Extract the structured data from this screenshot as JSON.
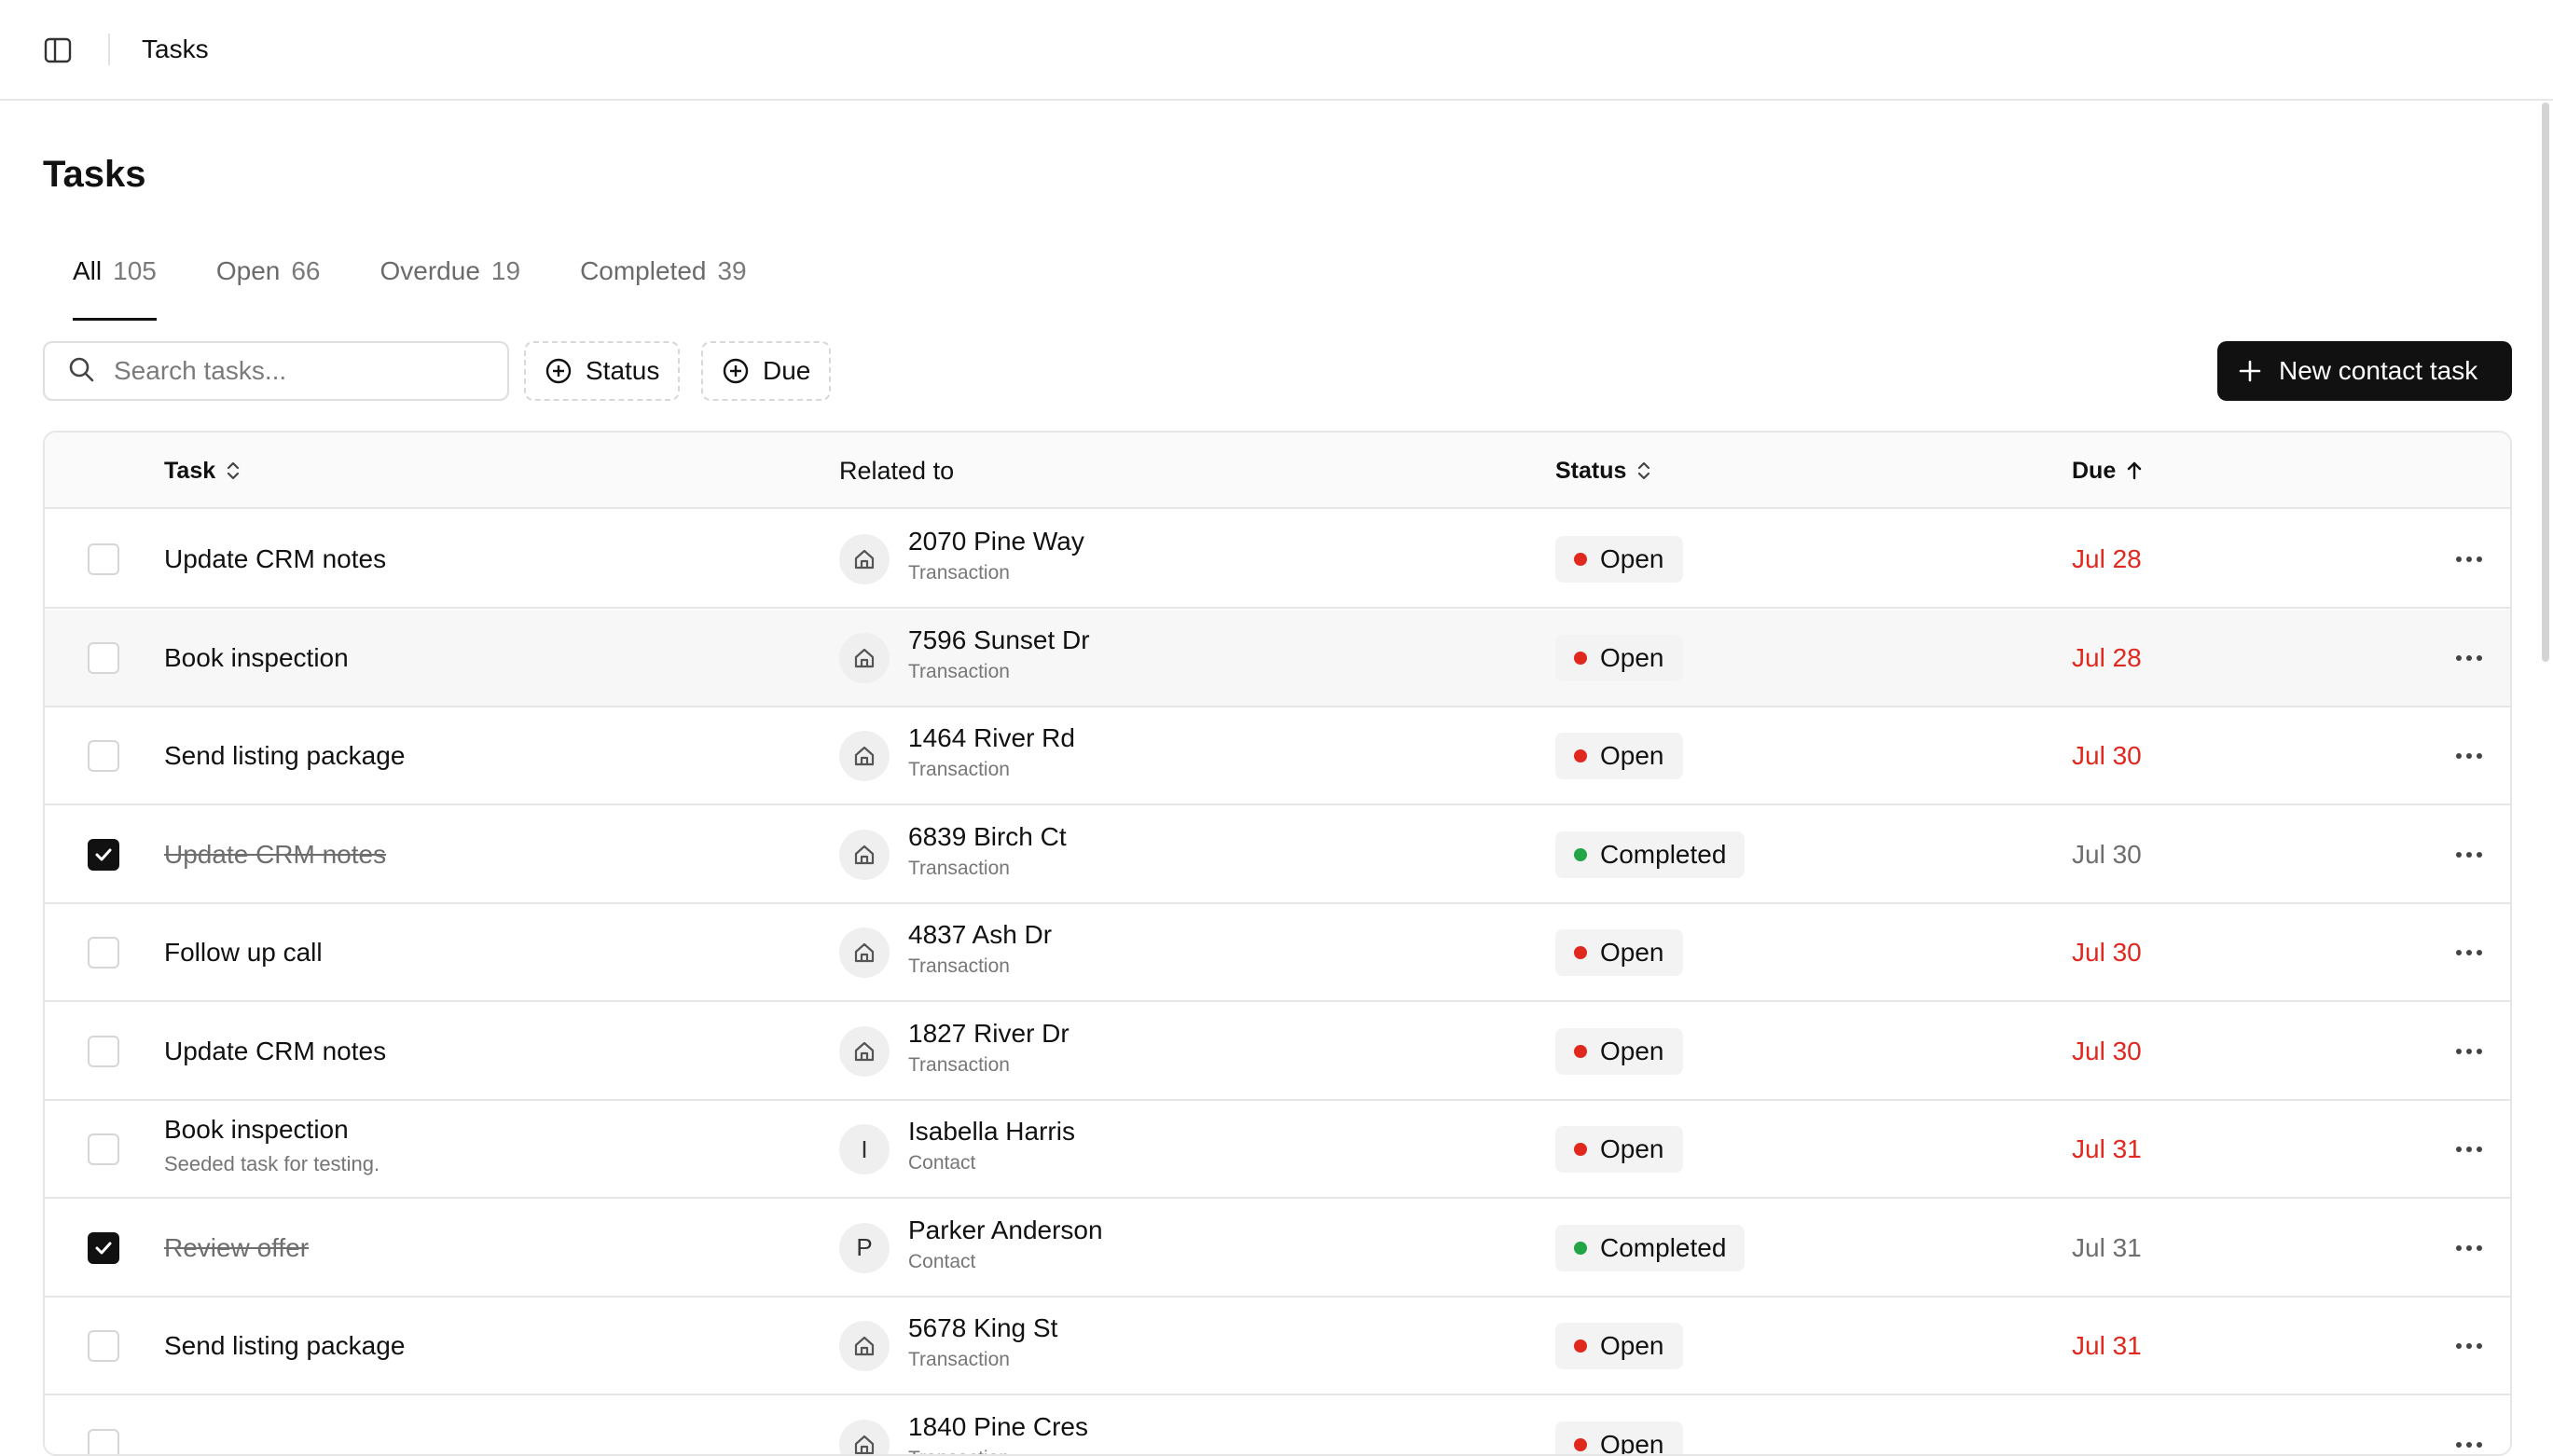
{
  "topbar": {
    "title": "Tasks"
  },
  "page": {
    "title": "Tasks"
  },
  "tabs": [
    {
      "label": "All",
      "count": "105",
      "active": true
    },
    {
      "label": "Open",
      "count": "66",
      "active": false
    },
    {
      "label": "Overdue",
      "count": "19",
      "active": false
    },
    {
      "label": "Completed",
      "count": "39",
      "active": false
    }
  ],
  "toolbar": {
    "search_placeholder": "Search tasks...",
    "filter_status": "Status",
    "filter_due": "Due",
    "new_task": "New contact task"
  },
  "table": {
    "headers": {
      "task": "Task",
      "related": "Related to",
      "status": "Status",
      "due": "Due"
    },
    "rows": [
      {
        "checked": false,
        "task": "Update CRM notes",
        "subtitle": "",
        "related_name": "2070 Pine Way",
        "related_type": "Transaction",
        "related_icon": "house-icon",
        "status": "Open",
        "due": "Jul 28",
        "overdue": true
      },
      {
        "checked": false,
        "task": "Book inspection",
        "subtitle": "",
        "related_name": "7596 Sunset Dr",
        "related_type": "Transaction",
        "related_icon": "house-icon",
        "status": "Open",
        "due": "Jul 28",
        "overdue": true
      },
      {
        "checked": false,
        "task": "Send listing package",
        "subtitle": "",
        "related_name": "1464 River Rd",
        "related_type": "Transaction",
        "related_icon": "house-icon",
        "status": "Open",
        "due": "Jul 30",
        "overdue": true
      },
      {
        "checked": true,
        "task": "Update CRM notes",
        "subtitle": "",
        "related_name": "6839 Birch Ct",
        "related_type": "Transaction",
        "related_icon": "house-icon",
        "status": "Completed",
        "due": "Jul 30",
        "overdue": false
      },
      {
        "checked": false,
        "task": "Follow up call",
        "subtitle": "",
        "related_name": "4837 Ash Dr",
        "related_type": "Transaction",
        "related_icon": "house-icon",
        "status": "Open",
        "due": "Jul 30",
        "overdue": true
      },
      {
        "checked": false,
        "task": "Update CRM notes",
        "subtitle": "",
        "related_name": "1827 River Dr",
        "related_type": "Transaction",
        "related_icon": "house-icon",
        "status": "Open",
        "due": "Jul 30",
        "overdue": true
      },
      {
        "checked": false,
        "task": "Book inspection",
        "subtitle": "Seeded task for testing.",
        "related_name": "Isabella Harris",
        "related_type": "Contact",
        "related_initial": "I",
        "status": "Open",
        "due": "Jul 31",
        "overdue": true
      },
      {
        "checked": true,
        "task": "Review offer",
        "subtitle": "",
        "related_name": "Parker Anderson",
        "related_type": "Contact",
        "related_initial": "P",
        "status": "Completed",
        "due": "Jul 31",
        "overdue": false
      },
      {
        "checked": false,
        "task": "Send listing package",
        "subtitle": "",
        "related_name": "5678 King St",
        "related_type": "Transaction",
        "related_icon": "house-icon",
        "status": "Open",
        "due": "Jul 31",
        "overdue": true
      },
      {
        "checked": false,
        "task": "",
        "subtitle": "",
        "related_name": "1840 Pine Cres",
        "related_type": "Transaction",
        "related_icon": "house-icon",
        "status": "Open",
        "due": "",
        "overdue": true
      }
    ]
  },
  "colors": {
    "status_open": "#e0281f",
    "status_completed": "#22a447",
    "overdue_text": "#e0281f",
    "primary_button": "#111111"
  }
}
